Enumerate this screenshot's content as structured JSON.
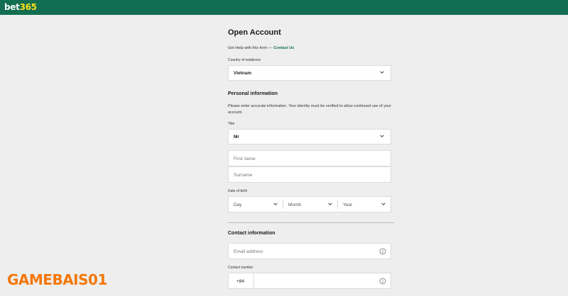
{
  "header": {
    "logo_part1": "bet",
    "logo_part2": "365",
    "colors": {
      "bar": "#126e51",
      "logo_accent": "#ffdf1b"
    }
  },
  "form": {
    "title": "Open Account",
    "help_text": "Get Help with this form —",
    "help_link": "Contact Us",
    "country": {
      "label": "Country of residence",
      "value": "Vietnam",
      "icon": "chevron-down-icon"
    },
    "personal": {
      "heading": "Personal information",
      "description": "Please enter accurate information. Your identity must be verified to allow continued use of your account.",
      "title_label": "Title",
      "title_value": "Mr",
      "first_name_placeholder": "First name",
      "surname_placeholder": "Surname",
      "dob_label": "Date of birth",
      "dob_day": "Day",
      "dob_month": "Month",
      "dob_year": "Year"
    },
    "contact": {
      "heading": "Contact information",
      "email_placeholder": "Email address",
      "phone_label": "Contact number",
      "phone_prefix": "+84",
      "info_icon": "info-icon"
    }
  },
  "watermark": {
    "text": "GAMEBAI",
    "suffix": "S01",
    "color": "#f4780a"
  }
}
